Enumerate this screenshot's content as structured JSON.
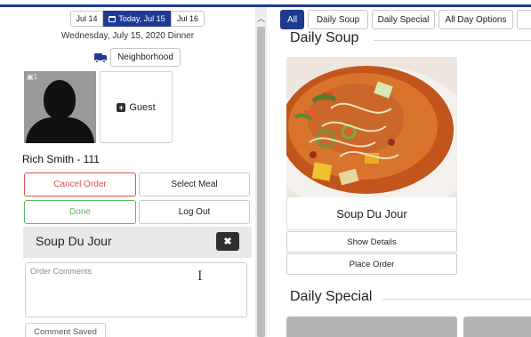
{
  "dates": {
    "prev": "Jul 14",
    "today": "Today, Jul 15",
    "next": "Jul 16",
    "selected_text": "Wednesday, July 15, 2020 Dinner"
  },
  "neighborhood_label": "Neighborhood",
  "resident": {
    "photo_badge": "1",
    "guest_label": "Guest",
    "name": "Rich Smith - 111"
  },
  "actions": {
    "cancel": "Cancel Order",
    "select_meal": "Select Meal",
    "done": "Done",
    "logout": "Log Out"
  },
  "order_item": {
    "name": "Soup Du Jour",
    "remove_symbol": "✖"
  },
  "comments": {
    "placeholder": "Order Comments",
    "value": "",
    "saved_label": "Comment Saved"
  },
  "menu_tabs": [
    "All",
    "Daily Soup",
    "Daily Special",
    "All Day Options"
  ],
  "sections": {
    "soup_title": "Daily Soup",
    "special_title": "Daily Special"
  },
  "soup_card": {
    "name": "Soup Du Jour",
    "details_label": "Show Details",
    "place_label": "Place Order"
  },
  "colors": {
    "brand_navy": "#1f3a93",
    "cancel_red": "#d9534f",
    "done_green": "#5cb85c",
    "dark_button": "#2f2f2f"
  },
  "icons": {
    "calendar": "calendar-icon",
    "truck": "truck-icon",
    "plus": "plus-square-icon",
    "remove": "close-icon",
    "scroll_up": "chevron-up-icon",
    "text_cursor": "text-cursor-icon"
  }
}
